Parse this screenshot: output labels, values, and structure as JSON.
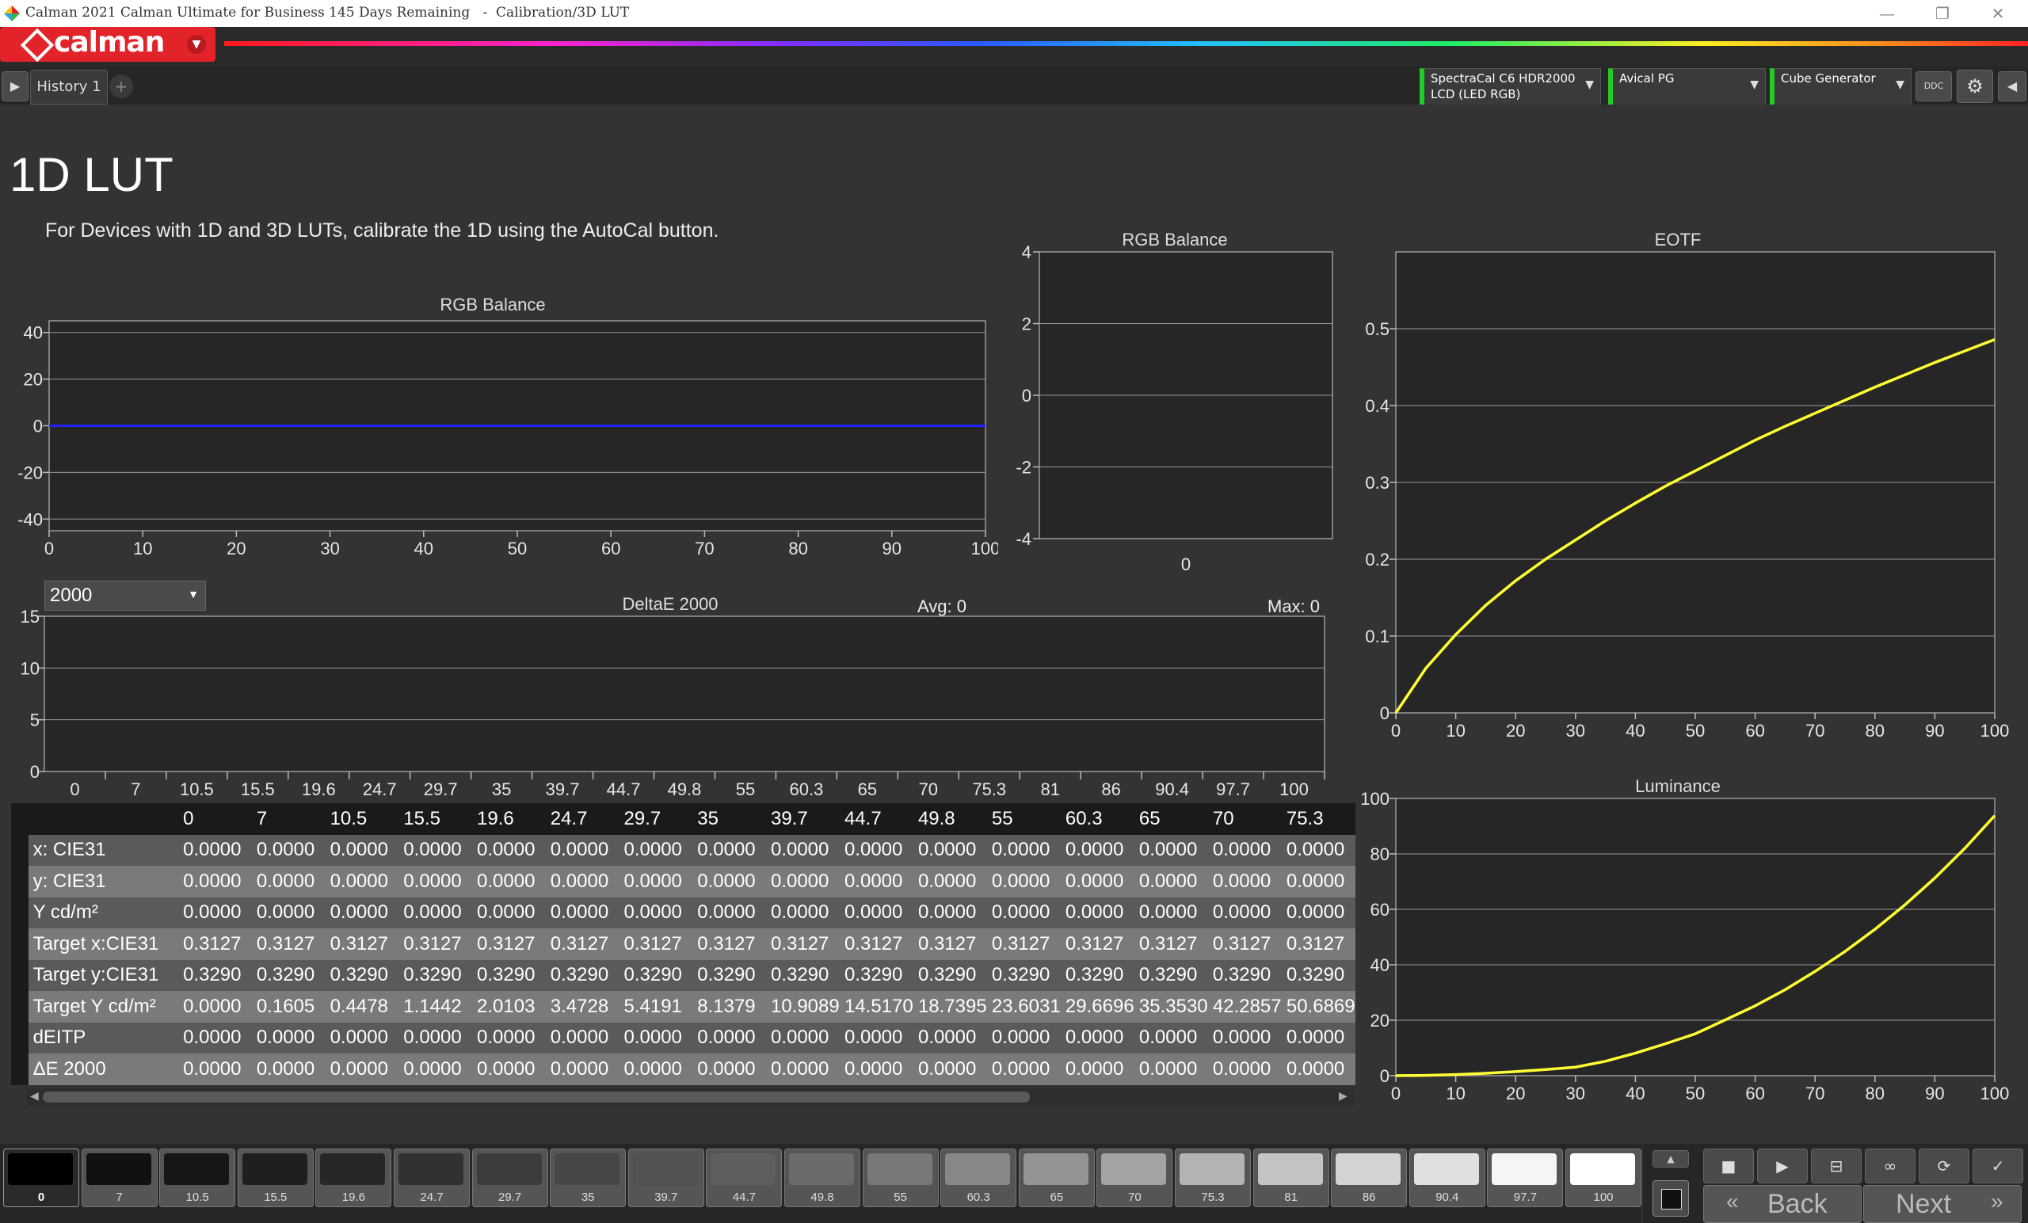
{
  "window": {
    "title": "Calman 2021 Calman Ultimate for Business 145 Days Remaining   -  Calibration/3D LUT"
  },
  "brand": {
    "logo_text": "calman"
  },
  "toolbar": {
    "tab": "History 1",
    "add_tab": "+",
    "meter": {
      "line1": "SpectraCal C6 HDR2000",
      "line2": "LCD (LED RGB)"
    },
    "pattern_gen": "Avical PG",
    "cube_gen": "Cube Generator",
    "ddc": "DDC"
  },
  "page": {
    "title": "1D LUT",
    "instruction": "For Devices with 1D and 3D LUTs, calibrate the 1D using the AutoCal button."
  },
  "charts": {
    "rgb_balance_main": {
      "title": "RGB Balance",
      "yticks": [
        "40",
        "20",
        "0",
        "-20",
        "-40"
      ],
      "xticks": [
        "0",
        "10",
        "20",
        "30",
        "40",
        "50",
        "60",
        "70",
        "80",
        "90",
        "100"
      ]
    },
    "rgb_balance_small": {
      "title": "RGB Balance",
      "yticks": [
        "4",
        "2",
        "0",
        "-2",
        "-4"
      ],
      "xticks": [
        "0"
      ]
    },
    "deltae": {
      "title": "DeltaE 2000",
      "avg": "Avg: 0",
      "max": "Max: 0",
      "select_value": "2000",
      "yticks": [
        "15",
        "10",
        "5",
        "0"
      ],
      "xticks": [
        "0",
        "7",
        "10.5",
        "15.5",
        "19.6",
        "24.7",
        "29.7",
        "35",
        "39.7",
        "44.7",
        "49.8",
        "55",
        "60.3",
        "65",
        "70",
        "75.3",
        "81",
        "86",
        "90.4",
        "97.7",
        "100"
      ]
    },
    "eotf": {
      "title": "EOTF",
      "yticks": [
        "0.5",
        "0.4",
        "0.3",
        "0.2",
        "0.1",
        "0"
      ],
      "xticks": [
        "0",
        "10",
        "20",
        "30",
        "40",
        "50",
        "60",
        "70",
        "80",
        "90",
        "100"
      ]
    },
    "luminance": {
      "title": "Luminance",
      "yticks": [
        "100",
        "80",
        "60",
        "40",
        "20",
        "0"
      ],
      "xticks": [
        "0",
        "10",
        "20",
        "30",
        "40",
        "50",
        "60",
        "70",
        "80",
        "90",
        "100"
      ]
    }
  },
  "chart_data": [
    {
      "type": "line",
      "title": "RGB Balance",
      "x": [
        0,
        10,
        20,
        30,
        40,
        50,
        60,
        70,
        80,
        90,
        100
      ],
      "series": [
        {
          "values": [
            0,
            0,
            0,
            0,
            0,
            0,
            0,
            0,
            0,
            0,
            0
          ],
          "color": "#2222ff"
        }
      ],
      "xlim": [
        0,
        100
      ],
      "ylim": [
        -45,
        45
      ],
      "grid": true
    },
    {
      "type": "bar",
      "title": "RGB Balance",
      "categories": [
        "0"
      ],
      "ylim": [
        -4,
        4
      ],
      "grid": true
    },
    {
      "type": "bar",
      "title": "DeltaE 2000",
      "categories": [
        "0",
        "7",
        "10.5",
        "15.5",
        "19.6",
        "24.7",
        "29.7",
        "35",
        "39.7",
        "44.7",
        "49.8",
        "55",
        "60.3",
        "65",
        "70",
        "75.3",
        "81",
        "86",
        "90.4",
        "97.7",
        "100"
      ],
      "values": [
        0,
        0,
        0,
        0,
        0,
        0,
        0,
        0,
        0,
        0,
        0,
        0,
        0,
        0,
        0,
        0,
        0,
        0,
        0,
        0,
        0
      ],
      "ylim": [
        0,
        15
      ],
      "grid": true
    },
    {
      "type": "line",
      "title": "EOTF",
      "x": [
        0,
        5,
        10,
        15,
        20,
        25,
        30,
        35,
        40,
        45,
        50,
        55,
        60,
        65,
        70,
        75,
        80,
        85,
        90,
        95,
        100
      ],
      "series": [
        {
          "values": [
            0,
            0.058,
            0.102,
            0.14,
            0.172,
            0.2,
            0.225,
            0.25,
            0.273,
            0.295,
            0.315,
            0.335,
            0.355,
            0.373,
            0.39,
            0.407,
            0.424,
            0.44,
            0.456,
            0.471,
            0.486
          ],
          "color": "#ffff33"
        }
      ],
      "xlim": [
        0,
        100
      ],
      "ylim": [
        0,
        0.6
      ],
      "grid": true
    },
    {
      "type": "line",
      "title": "Luminance",
      "x": [
        0,
        5,
        10,
        15,
        20,
        25,
        30,
        35,
        40,
        45,
        50,
        55,
        60,
        65,
        70,
        75,
        80,
        85,
        90,
        95,
        100
      ],
      "series": [
        {
          "values": [
            0,
            0.12,
            0.41,
            0.86,
            1.46,
            2.2,
            3.08,
            5.2,
            8.14,
            11.5,
            15.1,
            20.1,
            25.2,
            31.0,
            37.6,
            44.8,
            52.8,
            61.6,
            71.3,
            82.0,
            93.8
          ],
          "color": "#ffff33"
        }
      ],
      "xlim": [
        0,
        100
      ],
      "ylim": [
        0,
        100
      ],
      "grid": true
    }
  ],
  "table": {
    "columns": [
      "0",
      "7",
      "10.5",
      "15.5",
      "19.6",
      "24.7",
      "29.7",
      "35",
      "39.7",
      "44.7",
      "49.8",
      "55",
      "60.3",
      "65",
      "70",
      "75.3"
    ],
    "rows": [
      {
        "label": "x: CIE31",
        "values": [
          "0.0000",
          "0.0000",
          "0.0000",
          "0.0000",
          "0.0000",
          "0.0000",
          "0.0000",
          "0.0000",
          "0.0000",
          "0.0000",
          "0.0000",
          "0.0000",
          "0.0000",
          "0.0000",
          "0.0000",
          "0.0000"
        ]
      },
      {
        "label": "y: CIE31",
        "values": [
          "0.0000",
          "0.0000",
          "0.0000",
          "0.0000",
          "0.0000",
          "0.0000",
          "0.0000",
          "0.0000",
          "0.0000",
          "0.0000",
          "0.0000",
          "0.0000",
          "0.0000",
          "0.0000",
          "0.0000",
          "0.0000"
        ]
      },
      {
        "label": "Y cd/m²",
        "values": [
          "0.0000",
          "0.0000",
          "0.0000",
          "0.0000",
          "0.0000",
          "0.0000",
          "0.0000",
          "0.0000",
          "0.0000",
          "0.0000",
          "0.0000",
          "0.0000",
          "0.0000",
          "0.0000",
          "0.0000",
          "0.0000"
        ]
      },
      {
        "label": "Target x:CIE31",
        "values": [
          "0.3127",
          "0.3127",
          "0.3127",
          "0.3127",
          "0.3127",
          "0.3127",
          "0.3127",
          "0.3127",
          "0.3127",
          "0.3127",
          "0.3127",
          "0.3127",
          "0.3127",
          "0.3127",
          "0.3127",
          "0.3127"
        ]
      },
      {
        "label": "Target y:CIE31",
        "values": [
          "0.3290",
          "0.3290",
          "0.3290",
          "0.3290",
          "0.3290",
          "0.3290",
          "0.3290",
          "0.3290",
          "0.3290",
          "0.3290",
          "0.3290",
          "0.3290",
          "0.3290",
          "0.3290",
          "0.3290",
          "0.3290"
        ]
      },
      {
        "label": "Target Y cd/m²",
        "values": [
          "0.0000",
          "0.1605",
          "0.4478",
          "1.1442",
          "2.0103",
          "3.4728",
          "5.4191",
          "8.1379",
          "10.9089",
          "14.5170",
          "18.7395",
          "23.6031",
          "29.6696",
          "35.3530",
          "42.2857",
          "50.6869"
        ]
      },
      {
        "label": "dEITP",
        "values": [
          "0.0000",
          "0.0000",
          "0.0000",
          "0.0000",
          "0.0000",
          "0.0000",
          "0.0000",
          "0.0000",
          "0.0000",
          "0.0000",
          "0.0000",
          "0.0000",
          "0.0000",
          "0.0000",
          "0.0000",
          "0.0000"
        ]
      },
      {
        "label": "ΔE 2000",
        "values": [
          "0.0000",
          "0.0000",
          "0.0000",
          "0.0000",
          "0.0000",
          "0.0000",
          "0.0000",
          "0.0000",
          "0.0000",
          "0.0000",
          "0.0000",
          "0.0000",
          "0.0000",
          "0.0000",
          "0.0000",
          "0.0000"
        ]
      }
    ]
  },
  "swatches": [
    {
      "label": "0",
      "color": "#000000"
    },
    {
      "label": "7",
      "color": "#111111"
    },
    {
      "label": "10.5",
      "color": "#161616"
    },
    {
      "label": "15.5",
      "color": "#1f1f1f"
    },
    {
      "label": "19.6",
      "color": "#272727"
    },
    {
      "label": "24.7",
      "color": "#313131"
    },
    {
      "label": "29.7",
      "color": "#3c3c3c"
    },
    {
      "label": "35",
      "color": "#474747"
    },
    {
      "label": "39.7",
      "color": "#525252"
    },
    {
      "label": "44.7",
      "color": "#5e5e5e"
    },
    {
      "label": "49.8",
      "color": "#6b6b6b"
    },
    {
      "label": "55",
      "color": "#787878"
    },
    {
      "label": "60.3",
      "color": "#878787"
    },
    {
      "label": "65",
      "color": "#949494"
    },
    {
      "label": "70",
      "color": "#a3a3a3"
    },
    {
      "label": "75.3",
      "color": "#b3b3b3"
    },
    {
      "label": "81",
      "color": "#c4c4c4"
    },
    {
      "label": "86",
      "color": "#d3d3d3"
    },
    {
      "label": "90.4",
      "color": "#e0e0e0"
    },
    {
      "label": "97.7",
      "color": "#f5f5f5"
    },
    {
      "label": "100",
      "color": "#ffffff"
    }
  ],
  "nav": {
    "back": "Back",
    "next": "Next"
  }
}
